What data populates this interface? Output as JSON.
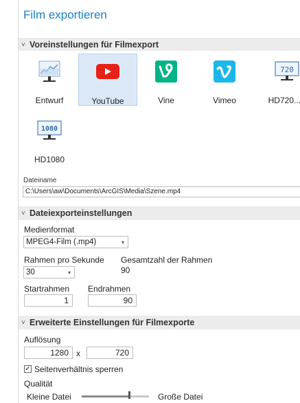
{
  "title": "Film exportieren",
  "presets_section": {
    "chevron": "˅",
    "label": "Voreinstellungen für Filmexport"
  },
  "presets": [
    {
      "label": "Entwurf",
      "icon": "draft-chart-icon"
    },
    {
      "label": "YouTube",
      "icon": "youtube-icon",
      "selected": true
    },
    {
      "label": "Vine",
      "icon": "vine-icon"
    },
    {
      "label": "Vimeo",
      "icon": "vimeo-icon"
    },
    {
      "label": "HD720...",
      "icon": "hd720-icon",
      "badge": "720"
    },
    {
      "label": "HD1080",
      "icon": "hd1080-icon",
      "badge": "1080"
    }
  ],
  "file": {
    "label": "Dateiname",
    "path": "C:\\Users\\aw\\Documents\\ArcGIS\\Media\\Szene.mp4"
  },
  "export_section": {
    "chevron": "˅",
    "label": "Dateiexporteinstellungen"
  },
  "media_format": {
    "label": "Medienformat",
    "value": "MPEG4-Film (.mp4)"
  },
  "fps": {
    "label": "Rahmen pro Sekunde",
    "value": "30"
  },
  "total_frames": {
    "label": "Gesamtzahl der Rahmen",
    "value": "90"
  },
  "start_frame": {
    "label": "Startrahmen",
    "value": "1"
  },
  "end_frame": {
    "label": "Endrahmen",
    "value": "90"
  },
  "advanced_section": {
    "chevron": "˅",
    "label": "Erweiterte Einstellungen für Filmexporte"
  },
  "resolution": {
    "label": "Auflösung",
    "width": "1280",
    "separator": "x",
    "height": "720"
  },
  "lock_aspect": {
    "label": "Seitenverhältnis sperren",
    "checked": true,
    "mark": "✓"
  },
  "quality": {
    "label": "Qualität",
    "min_label": "Kleine Datei",
    "max_label": "Große Datei",
    "level": 0.7
  },
  "colors": {
    "youtube": "#e62117",
    "vine": "#00b488",
    "vimeo": "#1ab7ea",
    "accent": "#1a7fc8"
  }
}
